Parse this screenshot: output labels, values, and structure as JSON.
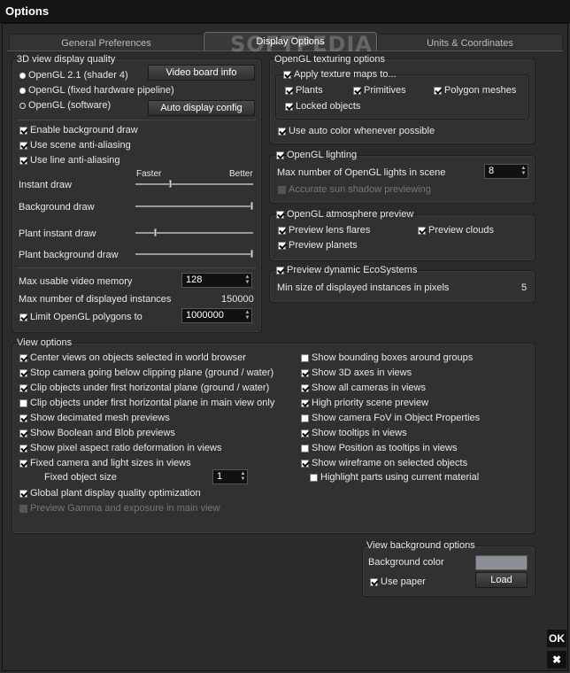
{
  "window": {
    "title": "Options",
    "watermark": "SOFTPEDIA"
  },
  "tabs": [
    "General Preferences",
    "Display Options",
    "Units & Coordinates"
  ],
  "quality": {
    "title": "3D view display quality",
    "radios": [
      "OpenGL 2.1 (shader 4)",
      "OpenGL (fixed hardware pipeline)",
      "OpenGL (software)"
    ],
    "video_board_info": "Video board info",
    "auto_display_config": "Auto display config",
    "checks": [
      "Enable background draw",
      "Use scene anti-aliasing",
      "Use line anti-aliasing"
    ],
    "faster": "Faster",
    "better": "Better",
    "sliders": [
      {
        "label": "Instant draw",
        "value": 0.29
      },
      {
        "label": "Background draw",
        "value": 1.0
      },
      {
        "label": "Plant instant draw",
        "value": 0.16
      },
      {
        "label": "Plant background draw",
        "value": 1.0
      }
    ],
    "max_video_memory_label": "Max usable video memory",
    "max_video_memory": "128",
    "max_instances_label": "Max number of displayed instances",
    "max_instances": "150000",
    "limit_polygons_label": "Limit OpenGL polygons to",
    "limit_polygons": "1000000"
  },
  "texturing": {
    "title": "OpenGL texturing options",
    "apply_maps": "Apply texture maps to...",
    "plants": "Plants",
    "primitives": "Primitives",
    "polygon_meshes": "Polygon meshes",
    "locked_objects": "Locked objects",
    "auto_color": "Use auto color whenever possible"
  },
  "lighting": {
    "title": "OpenGL lighting",
    "max_lights_label": "Max number of OpenGL lights in scene",
    "max_lights": "8",
    "sun_shadow": "Accurate sun shadow previewing"
  },
  "atmosphere": {
    "title": "OpenGL atmosphere preview",
    "lens_flares": "Preview lens flares",
    "clouds": "Preview clouds",
    "planets": "Preview planets"
  },
  "ecosystems": {
    "title": "Preview dynamic EcoSystems",
    "min_size_label": "Min size of displayed instances in pixels",
    "min_size": "5"
  },
  "view_options": {
    "title": "View options",
    "left": [
      {
        "label": "Center views on objects selected in world browser",
        "checked": true
      },
      {
        "label": "Stop camera going below clipping plane (ground / water)",
        "checked": true
      },
      {
        "label": "Clip objects under first horizontal plane (ground / water)",
        "checked": true
      },
      {
        "label": "Clip objects under first horizontal plane in main view only",
        "checked": false
      },
      {
        "label": "Show decimated mesh previews",
        "checked": true
      },
      {
        "label": "Show Boolean and Blob previews",
        "checked": true
      },
      {
        "label": "Show pixel aspect ratio deformation in views",
        "checked": true
      },
      {
        "label": "Fixed camera and light sizes in views",
        "checked": true
      }
    ],
    "fixed_object_size_label": "Fixed object size",
    "fixed_object_size": "1",
    "global_plant": "Global plant display quality optimization",
    "preview_gamma": "Preview Gamma and exposure in main view",
    "right": [
      {
        "label": "Show bounding boxes around groups",
        "checked": false
      },
      {
        "label": "Show 3D axes in views",
        "checked": true
      },
      {
        "label": "Show all cameras in views",
        "checked": true
      },
      {
        "label": "High priority scene preview",
        "checked": true
      },
      {
        "label": "Show camera FoV in Object Properties",
        "checked": false
      },
      {
        "label": "Show tooltips in views",
        "checked": true
      },
      {
        "label": "Show Position as tooltips in views",
        "checked": false
      },
      {
        "label": "Show wireframe on selected objects",
        "checked": true
      }
    ],
    "highlight_parts": "Highlight parts using current material"
  },
  "background": {
    "title": "View background options",
    "color_label": "Background color",
    "color": "#8a8f98",
    "use_paper": "Use paper",
    "load": "Load"
  },
  "footer": {
    "ok": "OK",
    "close": "✖"
  }
}
